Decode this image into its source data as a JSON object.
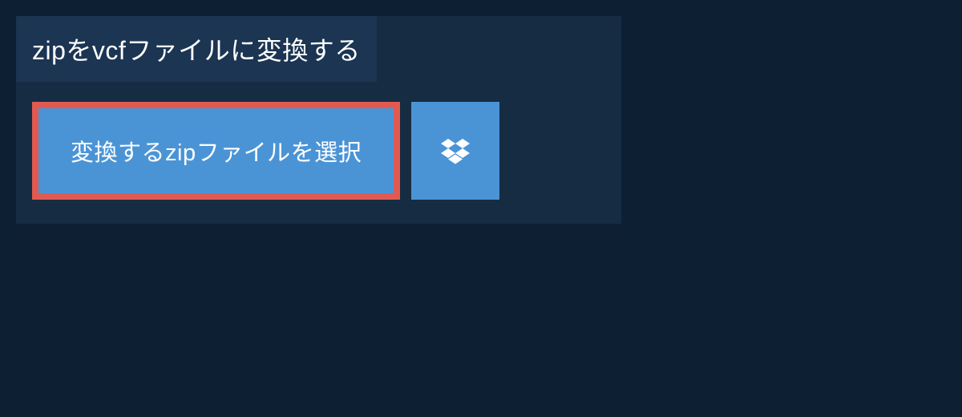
{
  "title": "zipをvcfファイルに変換する",
  "select_button_label": "変換するzipファイルを選択",
  "colors": {
    "background": "#0d1f33",
    "panel": "#162c42",
    "title_bar": "#1b3552",
    "button": "#4a94d6",
    "highlight_border": "#e05a52"
  }
}
